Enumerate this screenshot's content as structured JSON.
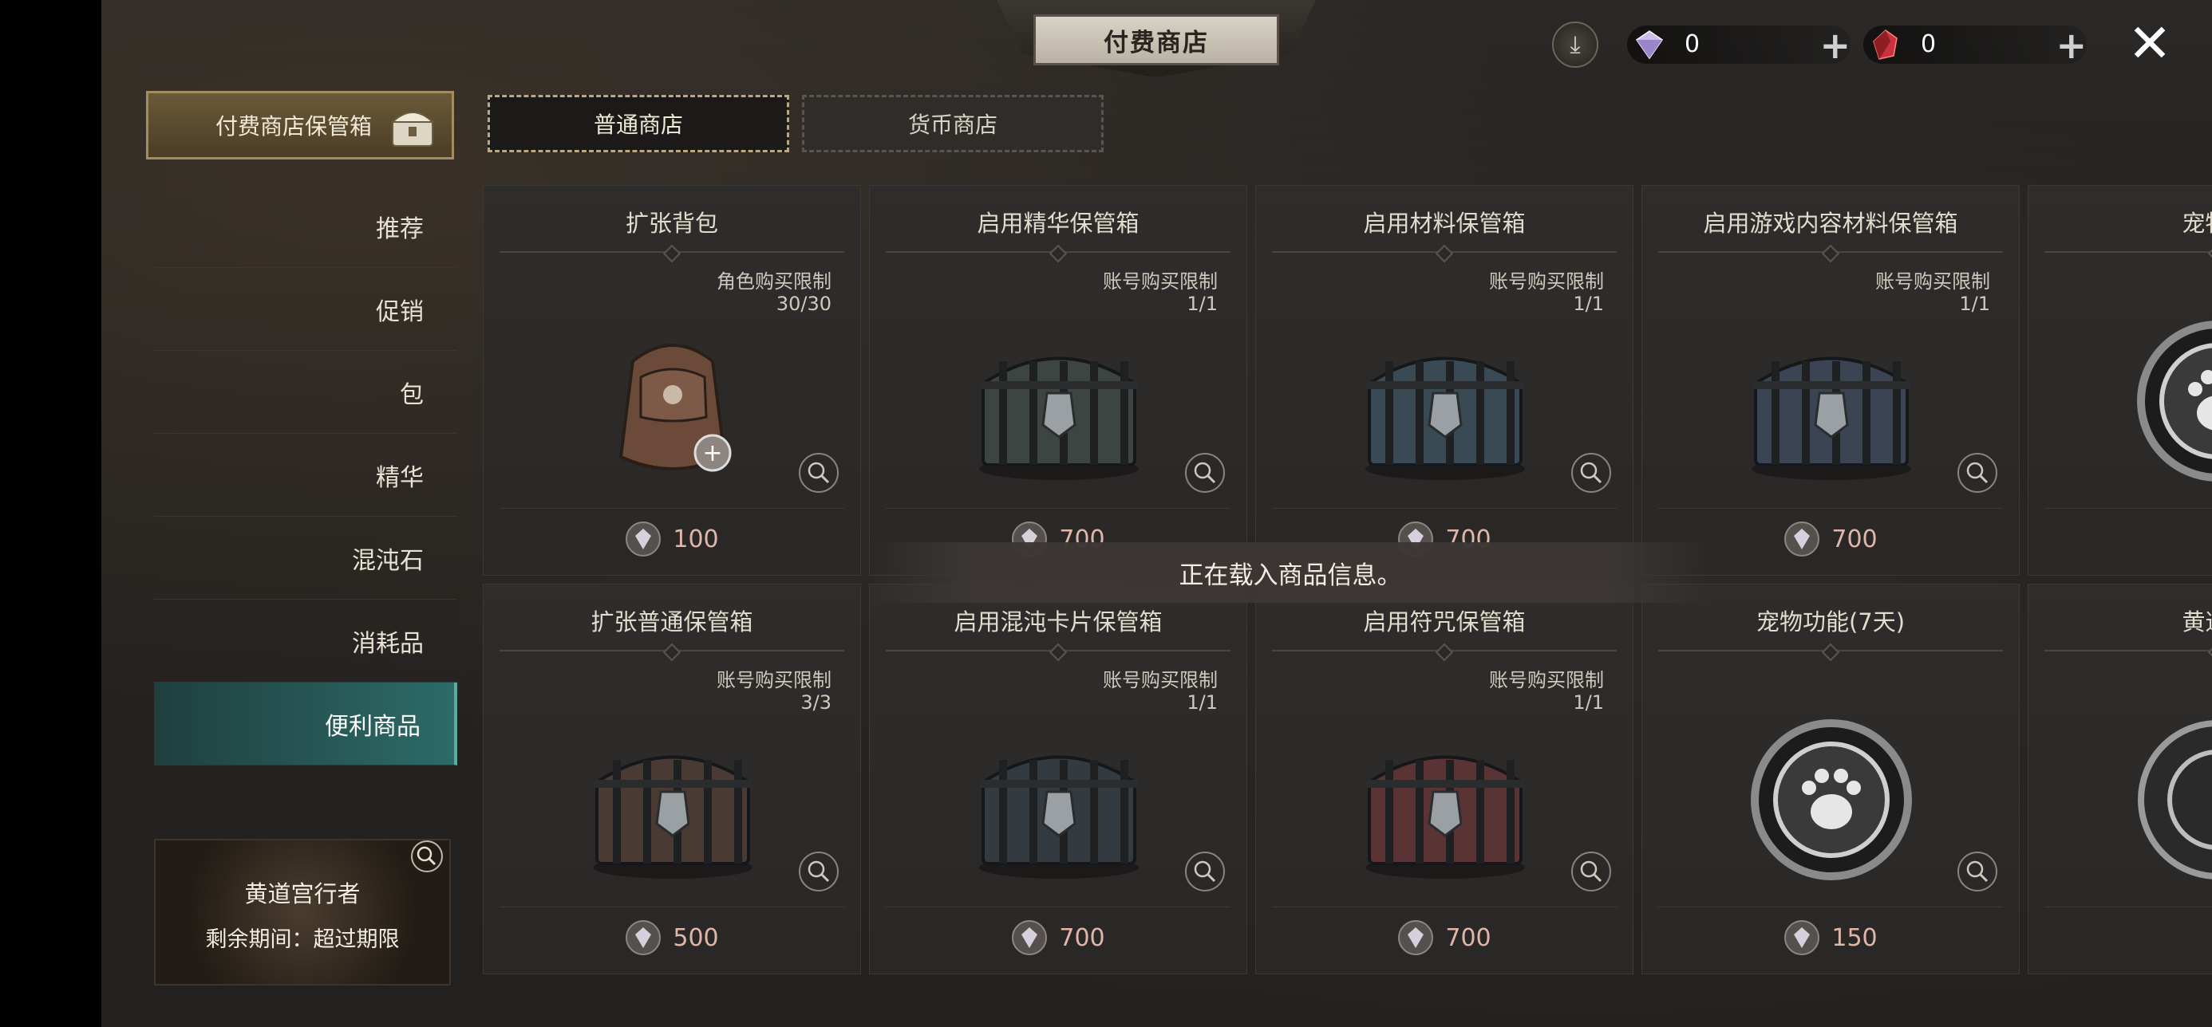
{
  "header": {
    "title": "付费商店"
  },
  "currency": [
    {
      "name": "diamond",
      "value": "0",
      "color": "#c9b6e8"
    },
    {
      "name": "ruby",
      "value": "0",
      "color": "#c8323c"
    }
  ],
  "storage_button": {
    "label": "付费商店保管箱"
  },
  "tabs": [
    {
      "label": "普通商店",
      "active": true
    },
    {
      "label": "货币商店",
      "active": false
    }
  ],
  "sidebar": {
    "items": [
      {
        "label": "推荐"
      },
      {
        "label": "促销"
      },
      {
        "label": "包"
      },
      {
        "label": "精华"
      },
      {
        "label": "混沌石"
      },
      {
        "label": "消耗品"
      },
      {
        "label": "便利商品",
        "active": true
      }
    ]
  },
  "zodiac_card": {
    "title": "黄道宫行者",
    "subtitle": "剩余期间：超过期限"
  },
  "loading_text": "正在载入商品信息。",
  "products": [
    {
      "name": "扩张背包",
      "limit_type": "角色购买限制",
      "limit_count": "30/30",
      "price": "100",
      "icon": "backpack-icon",
      "accent": "#6b4a3a"
    },
    {
      "name": "启用精华保管箱",
      "limit_type": "账号购买限制",
      "limit_count": "1/1",
      "price": "700",
      "icon": "chest-icon",
      "accent": "#3d4542"
    },
    {
      "name": "启用材料保管箱",
      "limit_type": "账号购买限制",
      "limit_count": "1/1",
      "price": "700",
      "icon": "chest-icon",
      "accent": "#3a4a55"
    },
    {
      "name": "启用游戏内容材料保管箱",
      "limit_type": "账号购买限制",
      "limit_count": "1/1",
      "price": "700",
      "icon": "chest-icon",
      "accent": "#3a4452"
    },
    {
      "name": "宠物功",
      "limit_type": "",
      "limit_count": "",
      "price": "",
      "icon": "pet-medallion-icon",
      "accent": "#555"
    },
    {
      "name": "扩张普通保管箱",
      "limit_type": "账号购买限制",
      "limit_count": "3/3",
      "price": "500",
      "icon": "chest-icon",
      "accent": "#4a3a34"
    },
    {
      "name": "启用混沌卡片保管箱",
      "limit_type": "账号购买限制",
      "limit_count": "1/1",
      "price": "700",
      "icon": "chest-icon",
      "accent": "#333a40"
    },
    {
      "name": "启用符咒保管箱",
      "limit_type": "账号购买限制",
      "limit_count": "1/1",
      "price": "700",
      "icon": "chest-icon",
      "accent": "#5a3434"
    },
    {
      "name": "宠物功能(7天)",
      "limit_type": "",
      "limit_count": "",
      "price": "150",
      "icon": "pet-medallion-icon",
      "accent": "#555"
    },
    {
      "name": "黄道宫",
      "limit_type": "",
      "limit_count": "",
      "price": "",
      "icon": "zodiac-icon",
      "accent": "#555"
    }
  ]
}
